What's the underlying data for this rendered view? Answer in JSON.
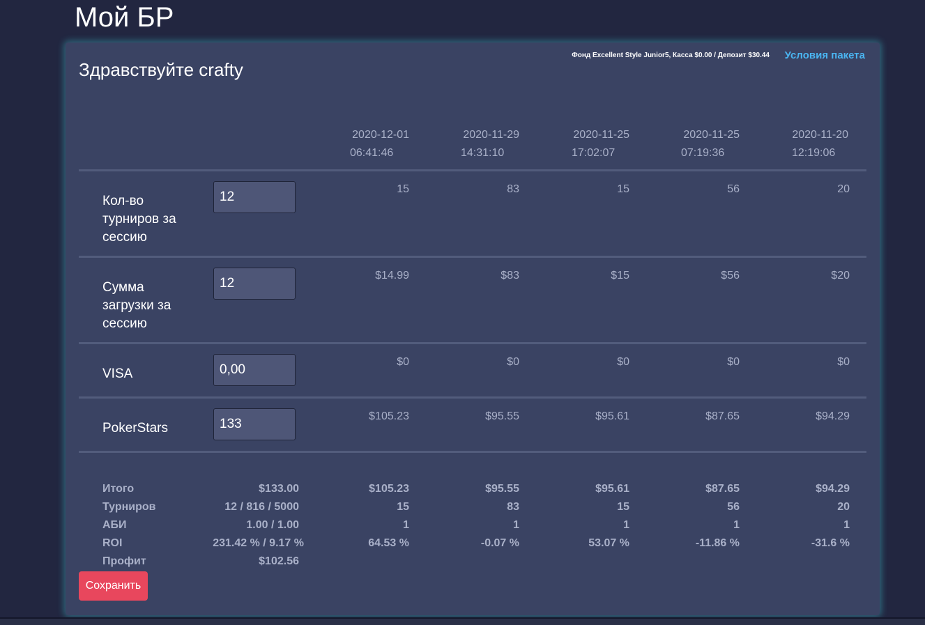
{
  "page": {
    "title": "Мой БР",
    "greeting": "Здравствуйте crafty",
    "fund_info": "Фонд Excellent Style Junior5, Касса $0.00 / Депозит $30.44",
    "terms_link": "Условия пакета",
    "save_label": "Сохранить"
  },
  "columns": [
    {
      "date": "2020-12-01",
      "time": "06:41:46"
    },
    {
      "date": "2020-11-29",
      "time": "14:31:10"
    },
    {
      "date": "2020-11-25",
      "time": "17:02:07"
    },
    {
      "date": "2020-11-25",
      "time": "07:19:36"
    },
    {
      "date": "2020-11-20",
      "time": "12:19:06"
    }
  ],
  "rows": [
    {
      "label": "Кол-во турниров за сессию",
      "input": "12",
      "values": [
        "15",
        "83",
        "15",
        "56",
        "20"
      ]
    },
    {
      "label": "Сумма загрузки за сессию",
      "input": "12",
      "values": [
        "$14.99",
        "$83",
        "$15",
        "$56",
        "$20"
      ]
    },
    {
      "label": "VISA",
      "input": "0,00",
      "values": [
        "$0",
        "$0",
        "$0",
        "$0",
        "$0"
      ]
    },
    {
      "label": "PokerStars",
      "input": "133",
      "values": [
        "$105.23",
        "$95.55",
        "$95.61",
        "$87.65",
        "$94.29"
      ]
    }
  ],
  "summary": [
    {
      "label": "Итого",
      "total": "$133.00",
      "values": [
        "$105.23",
        "$95.55",
        "$95.61",
        "$87.65",
        "$94.29"
      ]
    },
    {
      "label": "Турниров",
      "total": "12 / 816 / 5000",
      "values": [
        "15",
        "83",
        "15",
        "56",
        "20"
      ]
    },
    {
      "label": "АБИ",
      "total": "1.00 / 1.00",
      "values": [
        "1",
        "1",
        "1",
        "1",
        "1"
      ]
    },
    {
      "label": "ROI",
      "total": "231.42 % / 9.17 %",
      "values": [
        "64.53 %",
        "-0.07 %",
        "53.07 %",
        "-11.86 %",
        "-31.6 %"
      ]
    },
    {
      "label": "Профит",
      "total": "$102.56",
      "values": [
        "",
        "",
        "",
        "",
        ""
      ]
    }
  ]
}
